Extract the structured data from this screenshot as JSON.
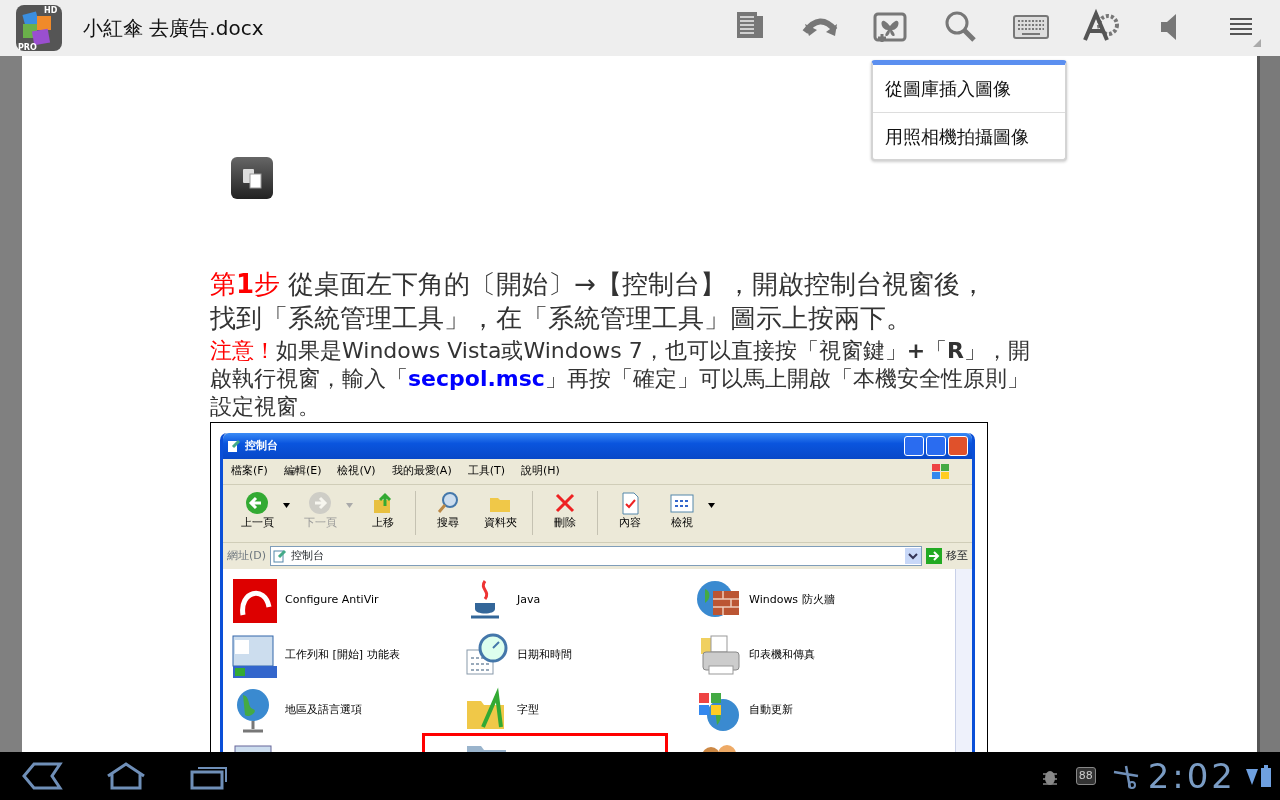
{
  "app_bar": {
    "logo_badges": [
      "HD",
      "PRO"
    ],
    "title": "小紅傘 去廣告.docx",
    "actions": [
      {
        "kind": "pages"
      },
      {
        "kind": "redo"
      },
      {
        "kind": "insert_image"
      },
      {
        "kind": "search"
      },
      {
        "kind": "keyboard"
      },
      {
        "kind": "text_settings"
      },
      {
        "kind": "speaker"
      },
      {
        "kind": "menu"
      }
    ]
  },
  "popup_menu": {
    "items": [
      "從圖庫插入圖像",
      "用照相機拍攝圖像"
    ]
  },
  "document": {
    "paragraphs": [
      {
        "kind": "step",
        "runs": [
          {
            "text": "第**1**步",
            "color": "#ff0000"
          },
          {
            "text": " 從桌面左下角的〔開始〕→【控制台】，開啟控制台視窗後，找到「系統管理工具」，在「系統管理工具」圖示上按兩下。",
            "color": "#333333"
          }
        ]
      },
      {
        "kind": "note",
        "runs": [
          {
            "text": "注意！",
            "color": "#ff0000"
          },
          {
            "text": "如果是Windows Vista或Windows 7，也可以直接按「視窗鍵」**+**「**R**」，開啟執行視窗，輸入「",
            "color": "#333333"
          },
          {
            "text": "**secpol.msc**",
            "color": "#0000ff"
          },
          {
            "text": "」再按「確定」可以馬上開啟「本機安全性原則」設定視窗。",
            "color": "#333333"
          }
        ]
      }
    ],
    "figure": {
      "title": "控制台",
      "menus": [
        "檔案(F)",
        "編輯(E)",
        "檢視(V)",
        "我的最愛(A)",
        "工具(T)",
        "說明(H)"
      ],
      "toolbar": [
        {
          "kind": "back",
          "label": "上一頁",
          "disabled": false,
          "dropdown": true,
          "separator_before": false
        },
        {
          "kind": "forward",
          "label": "下一頁",
          "disabled": true,
          "dropdown": true,
          "separator_before": false
        },
        {
          "kind": "up",
          "label": "上移",
          "disabled": false,
          "dropdown": false,
          "separator_before": false
        },
        {
          "kind": "search",
          "label": "搜尋",
          "disabled": false,
          "dropdown": false,
          "separator_before": true
        },
        {
          "kind": "folders",
          "label": "資料夾",
          "disabled": false,
          "dropdown": false,
          "separator_before": false
        },
        {
          "kind": "delete",
          "label": "刪除",
          "disabled": false,
          "dropdown": false,
          "separator_before": true
        },
        {
          "kind": "properties",
          "label": "內容",
          "disabled": false,
          "dropdown": false,
          "separator_before": true
        },
        {
          "kind": "views",
          "label": "檢視",
          "disabled": false,
          "dropdown": true,
          "separator_before": false
        }
      ],
      "address": {
        "label": "網址(D)",
        "value": "控制台",
        "go": "移至"
      },
      "items": [
        {
          "kind": "antivir",
          "label": "Configure AntiVir",
          "highlighted": false
        },
        {
          "kind": "java",
          "label": "Java",
          "highlighted": false
        },
        {
          "kind": "firewall",
          "label": "Windows 防火牆",
          "highlighted": false
        },
        {
          "kind": "taskbar",
          "label": "工作列和 [開始] 功能表",
          "highlighted": false
        },
        {
          "kind": "datetime",
          "label": "日期和時間",
          "highlighted": false
        },
        {
          "kind": "printers",
          "label": "印表機和傳真",
          "highlighted": false
        },
        {
          "kind": "globe",
          "label": "地區及語言選項",
          "highlighted": false
        },
        {
          "kind": "fonts",
          "label": "字型",
          "highlighted": false
        },
        {
          "kind": "update",
          "label": "自動更新",
          "highlighted": false
        },
        {
          "kind": "system",
          "highlighted": false
        },
        {
          "kind": "folder",
          "highlighted": true
        },
        {
          "kind": "users",
          "highlighted": false
        }
      ]
    }
  },
  "nav_bar": {
    "battery_badge": "88",
    "time": "2:02"
  }
}
